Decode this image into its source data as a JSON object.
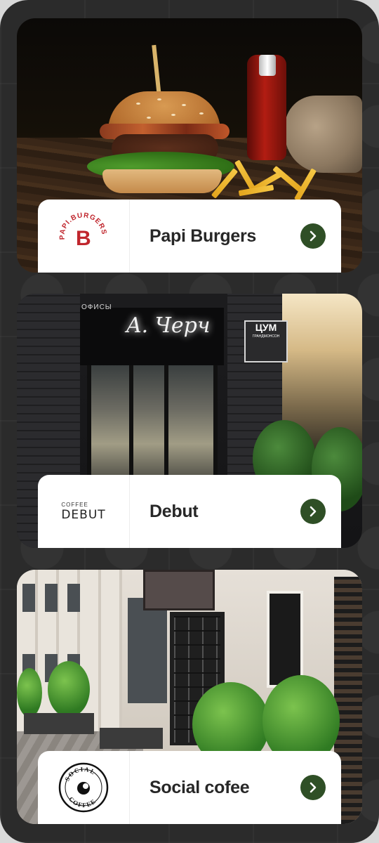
{
  "places": [
    {
      "name": "Papi Burgers",
      "logo_text": "PAPI.BURGERS",
      "logo_letter": "B",
      "accent": "#c0262d"
    },
    {
      "name": "Debut",
      "logo_top": "COFFEE",
      "logo_main": "DEBUT"
    },
    {
      "name": "Social cofee",
      "logo_top": "SOCIAL",
      "logo_bottom": "COFFEE"
    }
  ],
  "scene2": {
    "signage_small": "ОФИСЫ",
    "script_sign": "A. Черч",
    "store_sign": "ЦУМ",
    "store_sub": "ГРАНДМОНСОН"
  },
  "colors": {
    "button_bg": "#2f4f26",
    "background": "#2b2b2b",
    "card_bar": "#ffffff"
  }
}
